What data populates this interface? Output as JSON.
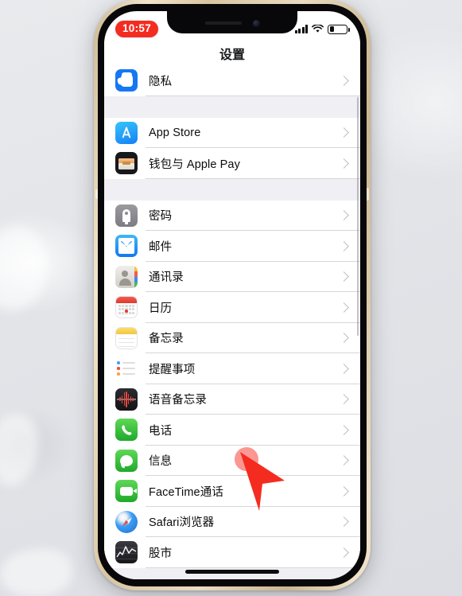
{
  "device": {
    "frame_color": "#d8c5a2",
    "bezel_color": "#08080a"
  },
  "status_bar": {
    "time": "10:57",
    "time_pill_color": "#f42c20",
    "signal_icon": "cellular-signal-icon",
    "wifi_icon": "wifi-icon",
    "battery_icon": "battery-icon",
    "battery_level_pct": 28
  },
  "nav": {
    "title": "设置"
  },
  "list": {
    "sections": [
      {
        "rows": [
          {
            "label": "隐私",
            "icon": "privacy-hand-icon",
            "icon_class": "ic-privacy"
          }
        ]
      },
      {
        "rows": [
          {
            "label": "App Store",
            "icon": "app-store-icon",
            "icon_class": "ic-appstore"
          },
          {
            "label": "钱包与 Apple Pay",
            "icon": "wallet-icon",
            "icon_class": "ic-wallet"
          }
        ]
      },
      {
        "rows": [
          {
            "label": "密码",
            "icon": "passwords-key-icon",
            "icon_class": "ic-pass"
          },
          {
            "label": "邮件",
            "icon": "mail-envelope-icon",
            "icon_class": "ic-mail"
          },
          {
            "label": "通讯录",
            "icon": "contacts-icon",
            "icon_class": "ic-contacts"
          },
          {
            "label": "日历",
            "icon": "calendar-icon",
            "icon_class": "ic-cal"
          },
          {
            "label": "备忘录",
            "icon": "notes-icon",
            "icon_class": "ic-notes"
          },
          {
            "label": "提醒事项",
            "icon": "reminders-icon",
            "icon_class": "ic-rem"
          },
          {
            "label": "语音备忘录",
            "icon": "voice-memos-icon",
            "icon_class": "ic-voice"
          },
          {
            "label": "电话",
            "icon": "phone-icon",
            "icon_class": "ic-phone"
          },
          {
            "label": "信息",
            "icon": "messages-icon",
            "icon_class": "ic-msg"
          },
          {
            "label": "FaceTime通话",
            "icon": "facetime-icon",
            "icon_class": "ic-ft"
          },
          {
            "label": "Safari浏览器",
            "icon": "safari-icon",
            "icon_class": "ic-safari"
          },
          {
            "label": "股市",
            "icon": "stocks-icon",
            "icon_class": "ic-stocks"
          }
        ]
      }
    ],
    "disclosure_icon": "chevron-right-icon"
  },
  "annotation": {
    "cursor_icon": "arrow-cursor-icon",
    "touch_indicator_icon": "touch-point-icon",
    "color": "#f42c20",
    "points_at": "信息"
  },
  "home_indicator": "home-indicator-bar"
}
